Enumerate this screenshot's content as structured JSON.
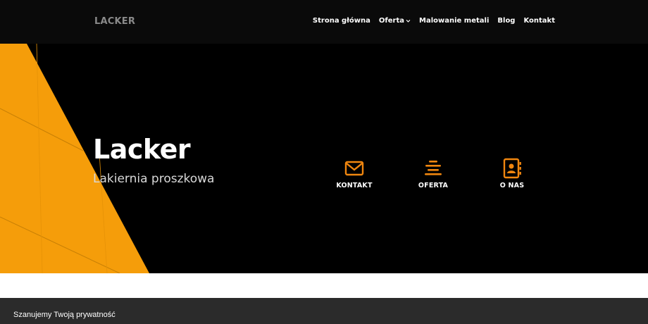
{
  "header": {
    "logo": "LACKER",
    "nav": [
      {
        "label": "Strona główna"
      },
      {
        "label": "Oferta",
        "has_dropdown": true,
        "dropdown_icon": "chevron-down-icon"
      },
      {
        "label": "Malowanie metali"
      },
      {
        "label": "Blog"
      },
      {
        "label": "Kontakt"
      }
    ]
  },
  "hero": {
    "title": "Lacker",
    "subtitle": "Lakiernia proszkowa",
    "quick_links": [
      {
        "label": "KONTAKT",
        "icon": "envelope-icon"
      },
      {
        "label": "OFERTA",
        "icon": "list-lines-icon"
      },
      {
        "label": "O NAS",
        "icon": "contact-book-icon"
      }
    ]
  },
  "cookie_banner": {
    "title": "Szanujemy Twoją prywatność"
  },
  "colors": {
    "accent": "#f0860f",
    "panel": "#f59d0a",
    "header_bg": "#0a0a0a",
    "hero_bg": "#000000",
    "cookie_bg": "#2b2b2b"
  }
}
